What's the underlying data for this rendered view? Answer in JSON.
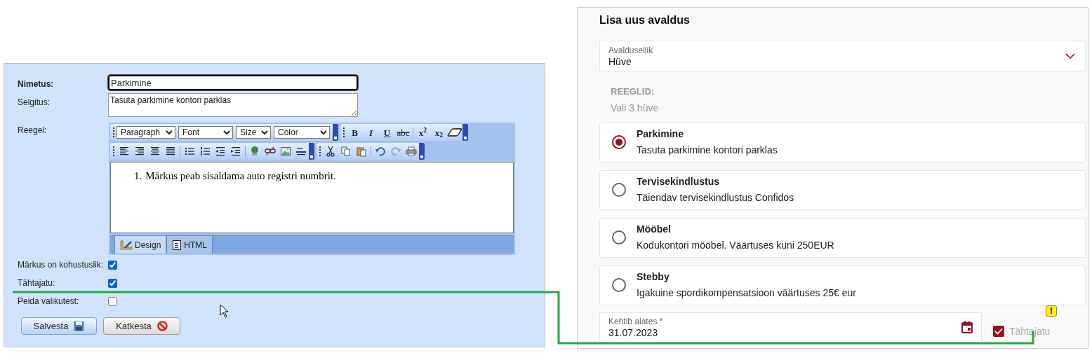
{
  "left_form": {
    "fields": [
      {
        "kind": "text",
        "label": "Nimetus:",
        "value": "Parkimine",
        "focused": true
      },
      {
        "kind": "textarea",
        "label": "Selgitus:",
        "value": "Tasuta parkimine kontori parklas"
      }
    ],
    "editor": {
      "label": "Reegel:",
      "dropdowns": [
        "Paragraph",
        "Font",
        "Size",
        "Color"
      ],
      "format_buttons": [
        "**B**",
        "*I*",
        "U",
        "abc",
        "x$^{2}$",
        "x$_{2}$"
      ],
      "content": [
        {
          "number": "1.",
          "text": "Märkus peab sisaldama auto registri numbrit."
        }
      ],
      "mode_tabs": [
        {
          "label": "Design",
          "selected": true
        },
        {
          "label": "HTML",
          "selected": false
        }
      ]
    },
    "checkboxes": [
      {
        "label": "Märkus on kohustuslik:",
        "checked": true
      },
      {
        "label": "Tähtajatu:",
        "checked": true
      },
      {
        "label": "Peida valikutest:",
        "checked": false
      }
    ],
    "buttons": [
      {
        "label": "Salvesta",
        "kind": "save"
      },
      {
        "label": "Katkesta",
        "kind": "cancel"
      }
    ]
  },
  "right_form": {
    "title": "Lisa uus avaldus",
    "type_select": {
      "label": "Avalduseliik",
      "value": "Hüve"
    },
    "rules": {
      "heading": "REEGLID:",
      "hint": "Vali 3 hüve"
    },
    "options": [
      {
        "title": "Parkimine",
        "description": "Tasuta parkimine kontori parklas",
        "selected": true
      },
      {
        "title": "Tervisekindlustus",
        "description": "Täiendav tervisekindlustus Confidos",
        "selected": false
      },
      {
        "title": "Mööbel",
        "description": "Kodukontori mööbel. Väärtuses kuni 250EUR",
        "selected": false
      },
      {
        "title": "Stebby",
        "description": "Igakuine spordikompensatsioon väärtuses 25€ eur",
        "selected": false
      }
    ],
    "date_field": {
      "label": "Kehtib alates *",
      "value": "31.07.2023"
    },
    "no_deadline": {
      "label": "Tähtajatu",
      "checked": true,
      "disabled": true,
      "warning": "!"
    }
  }
}
